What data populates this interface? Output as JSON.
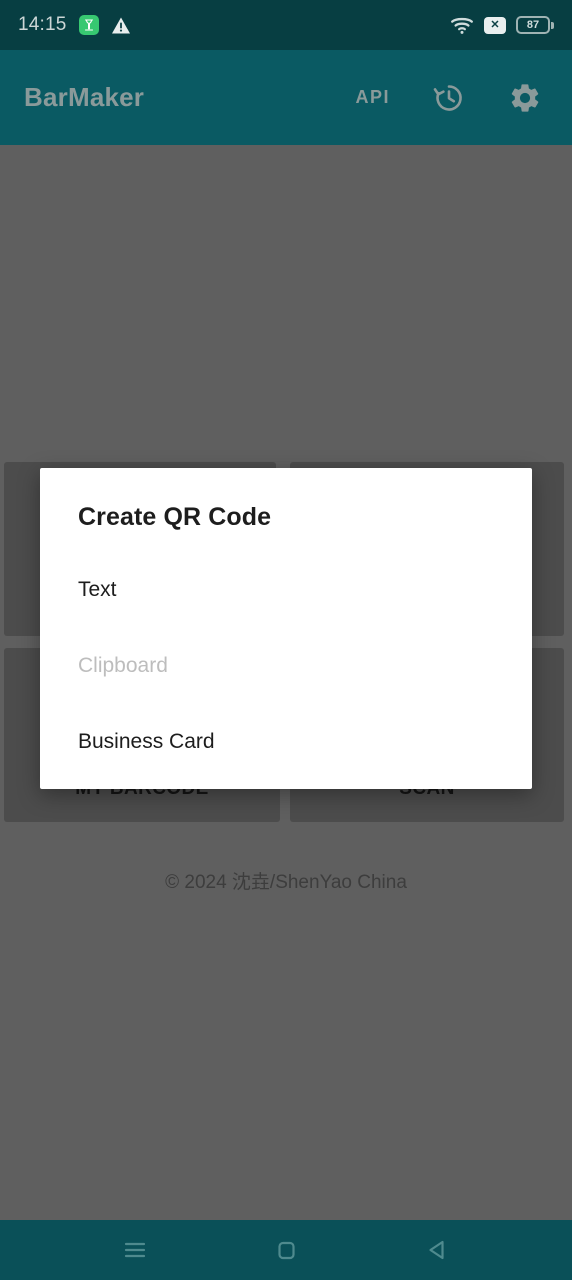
{
  "status_bar": {
    "time": "14:15",
    "background_color": "#073e42",
    "icons": [
      {
        "name": "app-notification-icon",
        "label": "",
        "color": "#37c871"
      },
      {
        "name": "warning-triangle-icon",
        "label": ""
      },
      {
        "name": "wifi-icon",
        "label": ""
      },
      {
        "name": "no-sim-icon",
        "label": "✕"
      }
    ],
    "battery": {
      "level": "87"
    }
  },
  "app_bar": {
    "title": "BarMaker",
    "background_color": "#0a5a63",
    "api_label": "API",
    "actions": [
      {
        "name": "api-button",
        "label": "API"
      },
      {
        "name": "history-icon",
        "label": ""
      },
      {
        "name": "settings-gear-icon",
        "label": ""
      }
    ]
  },
  "content": {
    "cards": [
      {
        "name": "card-create-qr",
        "label": ""
      },
      {
        "name": "card-history",
        "label": ""
      },
      {
        "name": "card-my-barcode",
        "label": "MY BARCODE"
      },
      {
        "name": "card-scan",
        "label": "SCAN"
      }
    ],
    "copyright": "© 2024 沈垚/ShenYao China"
  },
  "dialog": {
    "title": "Create QR Code",
    "items": [
      {
        "label": "Text",
        "disabled": false
      },
      {
        "label": "Clipboard",
        "disabled": true
      },
      {
        "label": "Business Card",
        "disabled": false
      }
    ]
  },
  "nav_bar": {
    "background_color": "#0a5058",
    "buttons": [
      {
        "name": "recents-button",
        "label": ""
      },
      {
        "name": "home-button",
        "label": ""
      },
      {
        "name": "back-button",
        "label": ""
      }
    ]
  },
  "colors": {
    "status_bar": "#073e42",
    "app_bar": "#0a5a63",
    "nav_bar": "#0a5058",
    "scrim": "#5f5f5f",
    "dialog_bg": "#ffffff",
    "accent_green": "#37c871"
  }
}
